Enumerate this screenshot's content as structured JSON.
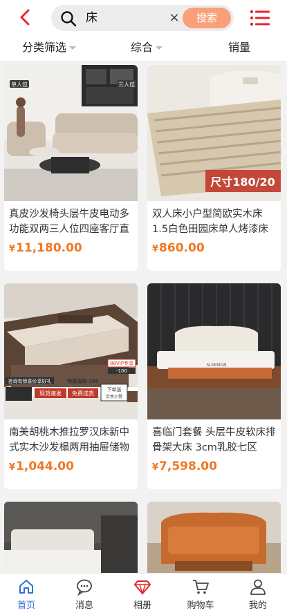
{
  "search": {
    "query": "床",
    "clear_label": "×",
    "button_label": "搜索"
  },
  "filters": [
    {
      "label": "分类筛选"
    },
    {
      "label": "综合"
    },
    {
      "label": "销量"
    }
  ],
  "products": [
    {
      "title": "真皮沙发椅头层牛皮电动多功能双两三人位四座客厅直",
      "currency": "¥",
      "price": "11,180.00",
      "badge_left": "单人位",
      "badge_right": "三人位"
    },
    {
      "title": "双人床小户型简欧实木床1.5白色田园床单人烤漆床",
      "currency": "¥",
      "price": "860.00",
      "overlay": "尺寸180/20"
    },
    {
      "title": "南美胡桃木推拉罗汉床新中式实木沙发榻两用抽屉储物",
      "currency": "¥",
      "price": "1,044.00",
      "promo_tags": [
        "咨询有惊喜价享好礼",
        "惊喜直降-100",
        "88VIP专享",
        "-100",
        "现货速发",
        "免费送货",
        "下单送",
        "实木小凳"
      ]
    },
    {
      "title": "喜临门套餐 头层牛皮软床排骨架大床 3cm乳胶七区",
      "currency": "¥",
      "price": "7,598.00",
      "brand": "SLEEMON"
    },
    {
      "title": "",
      "currency": "",
      "price": ""
    },
    {
      "title": "",
      "currency": "",
      "price": ""
    }
  ],
  "tabbar": [
    {
      "label": "首页",
      "icon": "home-icon",
      "active": true
    },
    {
      "label": "消息",
      "icon": "message-icon",
      "active": false
    },
    {
      "label": "相册",
      "icon": "album-gem-icon",
      "active": false
    },
    {
      "label": "购物车",
      "icon": "cart-icon",
      "active": false
    },
    {
      "label": "我的",
      "icon": "user-icon",
      "active": false
    }
  ],
  "colors": {
    "accent": "#e8232b",
    "price": "#f07823",
    "search_button": "#f9a07a",
    "active_tab": "#2f6dd9"
  }
}
